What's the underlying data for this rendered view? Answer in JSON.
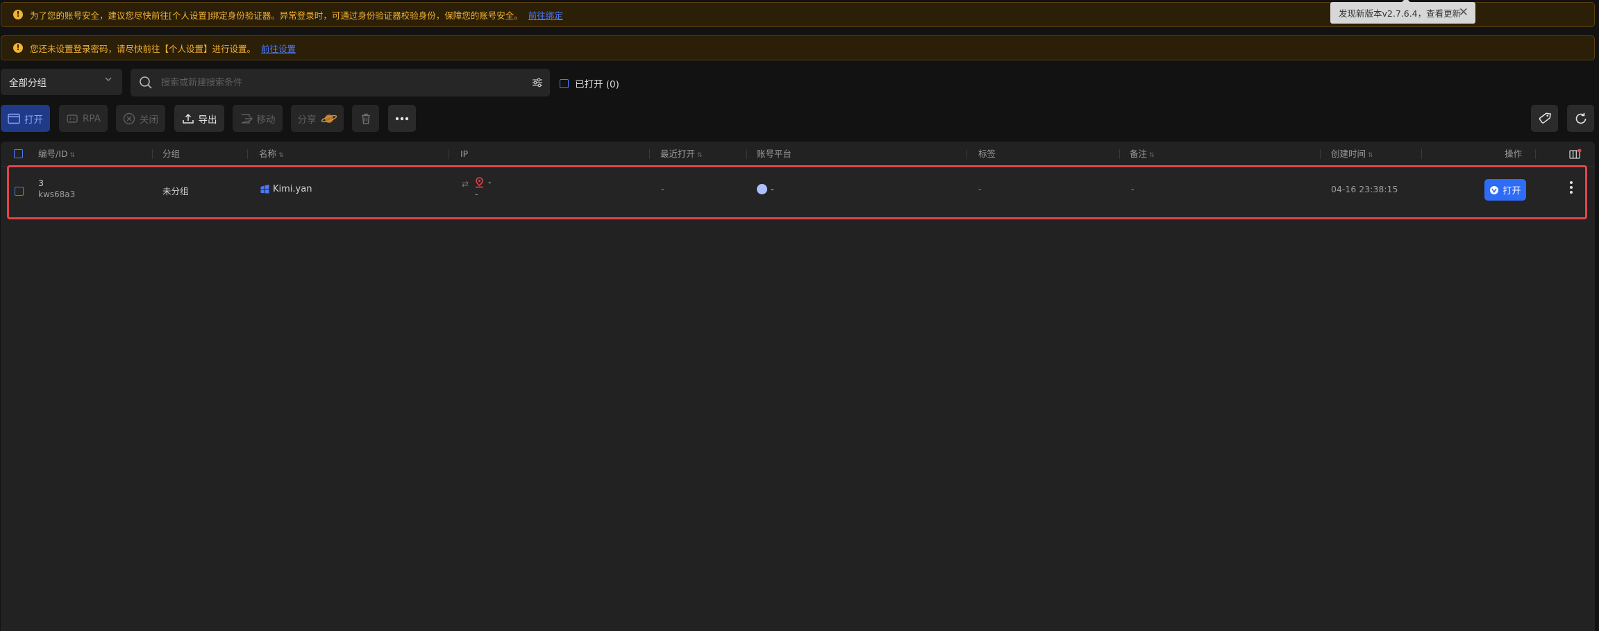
{
  "notices": {
    "security": {
      "text": "为了您的账号安全，建议您尽快前往[个人设置]绑定身份验证器。异常登录时，可通过身份验证器校验身份，保障您的账号安全。",
      "link": "前往绑定"
    },
    "password": {
      "text": "您还未设置登录密码，请尽快前往【个人设置】进行设置。",
      "link": "前往设置"
    },
    "warn_glyph": "!"
  },
  "update_toast": {
    "text": "发现新版本v2.7.6.4，查看更新",
    "close": "✕"
  },
  "filter": {
    "group_label": "全部分组",
    "search_placeholder": "搜索或新建搜索条件",
    "opened_label": "已打开 (0)"
  },
  "toolbar": {
    "open": "打开",
    "rpa": "RPA",
    "close": "关闭",
    "export": "导出",
    "move": "移动",
    "share": "分享"
  },
  "table": {
    "headers": {
      "id": "编号/ID",
      "group": "分组",
      "name": "名称",
      "ip": "IP",
      "last_open": "最近打开",
      "platform": "账号平台",
      "tags": "标签",
      "remark": "备注",
      "created": "创建时间",
      "actions": "操作"
    },
    "rows": [
      {
        "number": "3",
        "id": "kws68a3",
        "group": "未分组",
        "name": "Kimi.yan",
        "ip_value": "-",
        "ip_sub": "-",
        "last_open": "-",
        "platform": "-",
        "tags": "-",
        "remark": "-",
        "created": "04-16 23:38:15",
        "open_label": "打开"
      }
    ]
  },
  "colors": {
    "accent": "#2f6cf6",
    "warning": "#f2b233",
    "highlight_border": "#e0474a"
  }
}
